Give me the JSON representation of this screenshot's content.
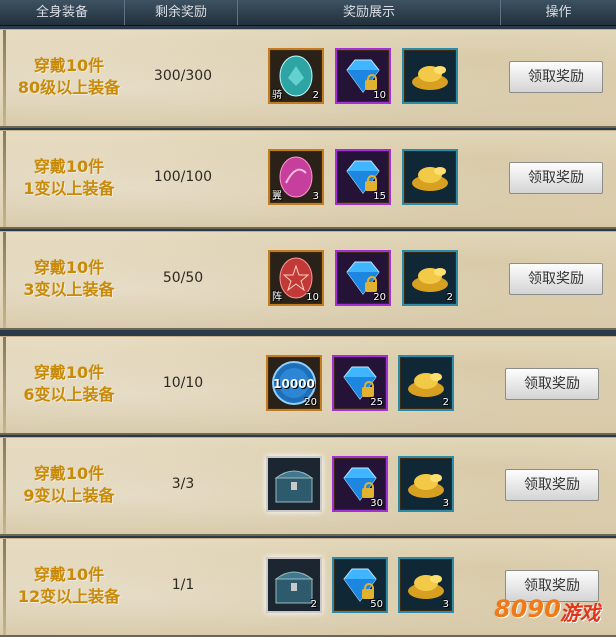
{
  "header": {
    "col_equip": "全身装备",
    "col_remaining": "剩余奖励",
    "col_rewards": "奖励展示",
    "col_action": "操作"
  },
  "rows": [
    {
      "line1": "穿戴10件",
      "line2": "80级以上装备",
      "remaining": "300/300",
      "items": [
        {
          "icon": "teal-gem-icon",
          "tag": "骑",
          "qty": "2"
        },
        {
          "icon": "diamond-locked-icon",
          "qty": "10"
        },
        {
          "icon": "gold-ingot-icon",
          "qty": ""
        }
      ],
      "button": "领取奖励"
    },
    {
      "line1": "穿戴10件",
      "line2": "1变以上装备",
      "remaining": "100/100",
      "items": [
        {
          "icon": "pink-gem-icon",
          "tag": "翼",
          "qty": "3"
        },
        {
          "icon": "diamond-locked-icon",
          "qty": "15"
        },
        {
          "icon": "gold-ingot-icon",
          "qty": ""
        }
      ],
      "button": "领取奖励"
    },
    {
      "line1": "穿戴10件",
      "line2": "3变以上装备",
      "remaining": "50/50",
      "items": [
        {
          "icon": "red-gem-icon",
          "tag": "阵",
          "qty": "10"
        },
        {
          "icon": "diamond-locked-icon",
          "qty": "20"
        },
        {
          "icon": "gold-ingot-icon",
          "qty": "2"
        }
      ],
      "button": "领取奖励"
    },
    {
      "line1": "穿戴10件",
      "line2": "6变以上装备",
      "remaining": "10/10",
      "items": [
        {
          "icon": "blue-coin-icon",
          "label": "10000",
          "qty": "20"
        },
        {
          "icon": "diamond-locked-icon",
          "qty": "25"
        },
        {
          "icon": "gold-ingot-icon",
          "qty": "2"
        }
      ],
      "button": "领取奖励"
    },
    {
      "line1": "穿戴10件",
      "line2": "9变以上装备",
      "remaining": "3/3",
      "items": [
        {
          "icon": "treasure-chest-icon",
          "qty": ""
        },
        {
          "icon": "diamond-locked-icon",
          "qty": "30"
        },
        {
          "icon": "gold-ingot-icon",
          "qty": "3"
        }
      ],
      "button": "领取奖励"
    },
    {
      "line1": "穿戴10件",
      "line2": "12变以上装备",
      "remaining": "1/1",
      "items": [
        {
          "icon": "treasure-chest-icon",
          "qty": "2"
        },
        {
          "icon": "diamond-locked-icon",
          "qty": "50"
        },
        {
          "icon": "gold-ingot-icon",
          "qty": "3"
        }
      ],
      "button": "领取奖励"
    }
  ],
  "watermark": {
    "digits": "8090",
    "text": "游戏"
  },
  "colors": {
    "title_gold": "#c98a08",
    "header_bg": "#2b3a48",
    "row_bg": "#e2d6bb"
  }
}
